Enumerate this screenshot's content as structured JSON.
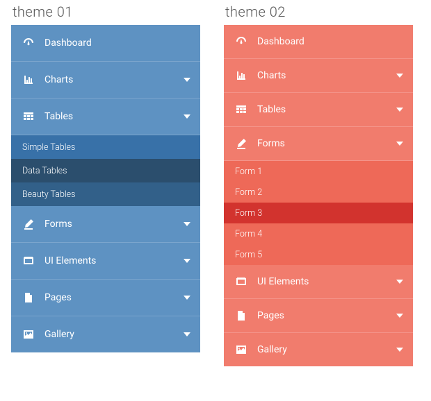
{
  "theme1": {
    "title": "theme 01",
    "items": [
      {
        "label": "Dashboard",
        "expandable": false
      },
      {
        "label": "Charts",
        "expandable": true
      },
      {
        "label": "Tables",
        "expandable": true
      },
      {
        "label": "Forms",
        "expandable": true
      },
      {
        "label": "UI Elements",
        "expandable": true
      },
      {
        "label": "Pages",
        "expandable": true
      },
      {
        "label": "Gallery",
        "expandable": true
      }
    ],
    "sub_tables": [
      {
        "label": "Simple Tables",
        "active": false
      },
      {
        "label": "Data Tables",
        "active": true
      },
      {
        "label": "Beauty Tables",
        "active": false
      }
    ]
  },
  "theme2": {
    "title": "theme 02",
    "items": [
      {
        "label": "Dashboard",
        "expandable": false
      },
      {
        "label": "Charts",
        "expandable": true
      },
      {
        "label": "Tables",
        "expandable": true
      },
      {
        "label": "Forms",
        "expandable": true
      },
      {
        "label": "UI Elements",
        "expandable": true
      },
      {
        "label": "Pages",
        "expandable": true
      },
      {
        "label": "Gallery",
        "expandable": true
      }
    ],
    "sub_forms": [
      {
        "label": "Form 1",
        "active": false
      },
      {
        "label": "Form 2",
        "active": false
      },
      {
        "label": "Form 3",
        "active": true
      },
      {
        "label": "Form 4",
        "active": false
      },
      {
        "label": "Form 5",
        "active": false
      }
    ]
  },
  "colors": {
    "theme1_base": "#5E92C2",
    "theme1_sub": "#3871A8",
    "theme1_sub_active": "#2B4E6D",
    "theme2_base": "#F17C6D",
    "theme2_sub": "#EE6958",
    "theme2_sub_active": "#D2332E"
  }
}
